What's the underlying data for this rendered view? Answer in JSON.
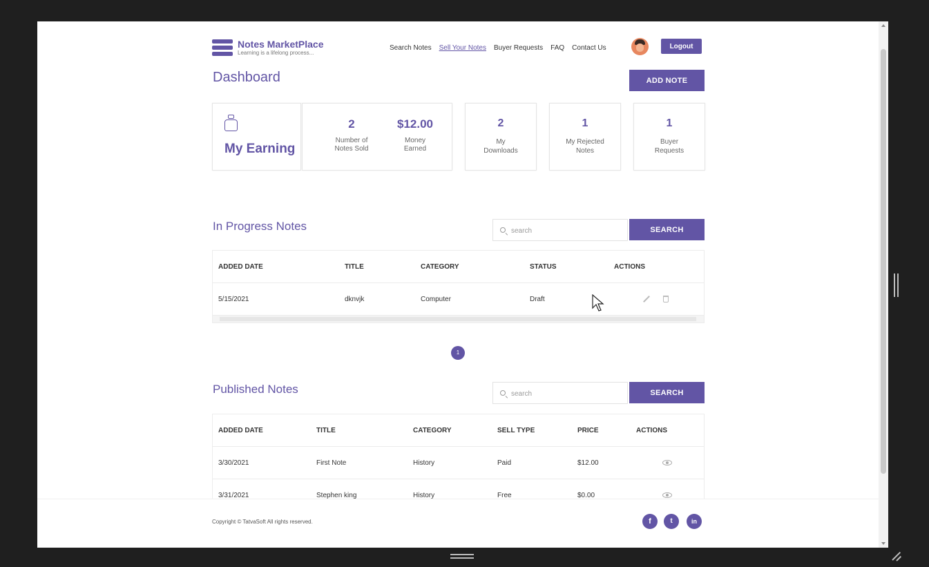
{
  "brand": {
    "title": "Notes MarketPlace",
    "tagline": "Learning is a lifelong process...",
    "accent": "#6255a5"
  },
  "nav": {
    "items": [
      "Search Notes",
      "Sell Your Notes",
      "Buyer Requests",
      "FAQ",
      "Contact Us"
    ],
    "active": "Sell Your Notes",
    "logout_label": "Logout"
  },
  "dashboard": {
    "title": "Dashboard",
    "add_note_label": "ADD NOTE",
    "earning_label": "My Earning",
    "notes_sold_value": "2",
    "notes_sold_label": "Number of Notes Sold",
    "money_value": "$12.00",
    "money_label": "Money Earned",
    "downloads_value": "2",
    "downloads_label": "My Downloads",
    "rejected_value": "1",
    "rejected_label": "My Rejected Notes",
    "buyer_value": "1",
    "buyer_label": "Buyer Requests"
  },
  "in_progress": {
    "title": "In Progress Notes",
    "search_placeholder": "search",
    "search_label": "SEARCH",
    "columns": [
      "ADDED DATE",
      "TITLE",
      "CATEGORY",
      "STATUS",
      "ACTIONS"
    ],
    "rows": [
      {
        "date": "5/15/2021",
        "title": "dknvjk",
        "category": "Computer",
        "status": "Draft"
      }
    ],
    "page": "1"
  },
  "published": {
    "title": "Published Notes",
    "search_placeholder": "search",
    "search_label": "SEARCH",
    "columns": [
      "ADDED DATE",
      "TITLE",
      "CATEGORY",
      "SELL TYPE",
      "PRICE",
      "ACTIONS"
    ],
    "rows": [
      {
        "date": "3/30/2021",
        "title": "First Note",
        "category": "History",
        "sell_type": "Paid",
        "price": "$12.00"
      },
      {
        "date": "3/31/2021",
        "title": "Stephen king",
        "category": "History",
        "sell_type": "Free",
        "price": "$0.00"
      }
    ]
  },
  "footer": {
    "copyright": "Copyright © TatvaSoft All rights reserved.",
    "social": [
      "f",
      "t",
      "in"
    ]
  },
  "icons": [
    "logo-icon",
    "money-bag-icon",
    "search-icon",
    "pencil-icon",
    "trash-icon",
    "eye-icon",
    "facebook-icon",
    "twitter-icon",
    "linkedin-icon"
  ]
}
